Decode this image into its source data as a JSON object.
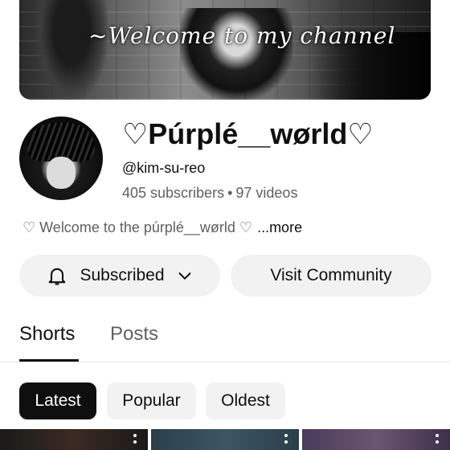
{
  "banner": {
    "title": "~Welcome to my channel"
  },
  "channel": {
    "name": "♡Púrplé__wørld♡",
    "handle": "@kim-su-reo",
    "subscribers": "405 subscribers",
    "separator": "•",
    "videos": "97 videos",
    "description": "♡ Welcome to the púrplé__wørld ♡",
    "more_label": "...more"
  },
  "actions": {
    "subscribed_label": "Subscribed",
    "community_label": "Visit Community"
  },
  "tabs": [
    {
      "label": "Shorts",
      "selected": true
    },
    {
      "label": "Posts",
      "selected": false
    }
  ],
  "chips": [
    {
      "label": "Latest",
      "selected": true
    },
    {
      "label": "Popular",
      "selected": false
    },
    {
      "label": "Oldest",
      "selected": false
    }
  ],
  "icons": {
    "bell": "bell-icon",
    "chevron": "chevron-down-icon",
    "kebab": "more-vert-icon"
  },
  "colors": {
    "text_primary": "#0f0f0f",
    "text_secondary": "#606060",
    "button_bg": "#f2f2f2",
    "chip_selected_bg": "#0f0f0f"
  }
}
